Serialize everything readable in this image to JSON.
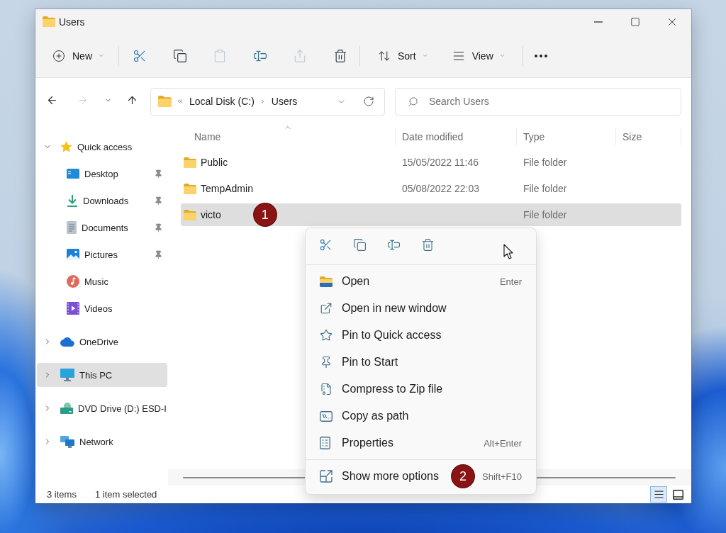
{
  "window": {
    "title": "Users"
  },
  "command_bar": {
    "new": {
      "label": "New"
    },
    "actions": [
      {
        "kind": "cut",
        "disabled": false
      },
      {
        "kind": "copy",
        "disabled": false
      },
      {
        "kind": "paste",
        "disabled": true
      },
      {
        "kind": "rename",
        "disabled": false
      },
      {
        "kind": "share",
        "disabled": true
      },
      {
        "kind": "delete",
        "disabled": false
      }
    ],
    "sort": {
      "label": "Sort"
    },
    "view": {
      "label": "View"
    }
  },
  "navigation": [
    {
      "kind": "back",
      "disabled": false
    },
    {
      "kind": "forward",
      "disabled": true
    },
    {
      "kind": "recent",
      "disabled": false
    },
    {
      "kind": "up",
      "disabled": false
    }
  ],
  "address_bar": {
    "path": [
      "Local Disk (C:)",
      "Users"
    ]
  },
  "search": {
    "placeholder": "Search Users"
  },
  "sidebar": {
    "items": [
      {
        "kind": "quick",
        "label": "Quick access",
        "expanded": true,
        "selected": false,
        "children": [
          {
            "kind": "desktop",
            "label": "Desktop",
            "pinned": true,
            "selected": false
          },
          {
            "kind": "downloads",
            "label": "Downloads",
            "pinned": true,
            "selected": false
          },
          {
            "kind": "documents",
            "label": "Documents",
            "pinned": true,
            "selected": false
          },
          {
            "kind": "pictures",
            "label": "Pictures",
            "pinned": true,
            "selected": false
          },
          {
            "kind": "music",
            "label": "Music",
            "pinned": false,
            "selected": false
          },
          {
            "kind": "videos",
            "label": "Videos",
            "pinned": false,
            "selected": false
          }
        ]
      },
      {
        "kind": "cloud",
        "label": "OneDrive",
        "expanded": false,
        "selected": false
      },
      {
        "kind": "pc",
        "label": "This PC",
        "expanded": false,
        "selected": true
      },
      {
        "kind": "dvd",
        "label": "DVD Drive (D:) ESD-I",
        "expanded": false,
        "selected": false
      },
      {
        "kind": "network",
        "label": "Network",
        "expanded": false,
        "selected": false
      }
    ]
  },
  "file_list": {
    "columns": [
      {
        "label": "Name",
        "sorted": true
      },
      {
        "label": "Date modified",
        "sorted": false
      },
      {
        "label": "Type",
        "sorted": false
      },
      {
        "label": "Size",
        "sorted": false
      }
    ],
    "rows": [
      {
        "name": "Public",
        "date_modified": "15/05/2022 11:46",
        "type": "File folder",
        "selected": false
      },
      {
        "name": "TempAdmin",
        "date_modified": "05/08/2022 22:03",
        "type": "File folder",
        "selected": false
      },
      {
        "name": "victo",
        "type": "File folder",
        "selected": true,
        "badge": "1"
      }
    ]
  },
  "context_menu": {
    "quick_actions": [
      {
        "kind": "cut"
      },
      {
        "kind": "copy"
      },
      {
        "kind": "rename"
      },
      {
        "kind": "delete"
      }
    ],
    "items": [
      {
        "kind": "open",
        "label": "Open",
        "shortcut": "Enter"
      },
      {
        "kind": "window",
        "label": "Open in new window"
      },
      {
        "kind": "star",
        "label": "Pin to Quick access"
      },
      {
        "kind": "pin",
        "label": "Pin to Start"
      },
      {
        "kind": "zip",
        "label": "Compress to Zip file"
      },
      {
        "kind": "path",
        "label": "Copy as path"
      },
      {
        "kind": "properties",
        "label": "Properties",
        "shortcut": "Alt+Enter"
      }
    ],
    "more": {
      "label": "Show more options",
      "shortcut": "Shift+F10",
      "badge": "2"
    }
  },
  "status_bar": {
    "item_count": "3 items",
    "selection": "1 item selected",
    "views": [
      {
        "kind": "details",
        "selected": true
      },
      {
        "kind": "tiles",
        "selected": false
      }
    ]
  }
}
